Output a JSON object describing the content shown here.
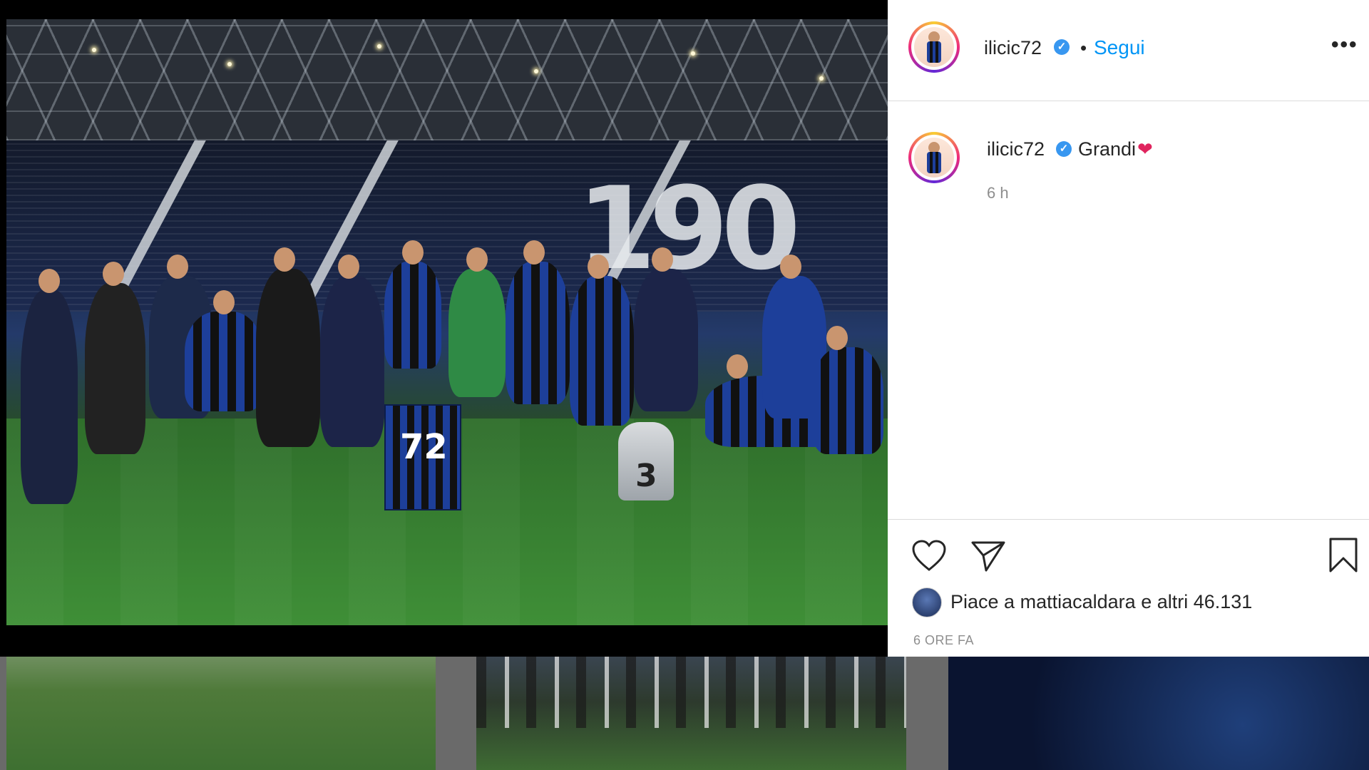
{
  "post": {
    "username": "ilicic72",
    "follow_label": "Segui",
    "separator": "•",
    "more_label": "•••",
    "caption": {
      "username": "ilicic72",
      "text": "Grandi",
      "emoji": "❤",
      "time": "6 h"
    },
    "photo": {
      "jersey_number": "72",
      "trophy_number": "3",
      "stand_numeral": "190"
    },
    "likes": {
      "prefix": "Piace a",
      "liked_by": "mattiacaldara",
      "connector": "e altri",
      "count": "46.131"
    },
    "age": "6 ORE FA"
  },
  "icons": {
    "like": "heart-outline-icon",
    "share": "paper-plane-icon",
    "save": "bookmark-icon",
    "verified": "verified-badge-icon"
  },
  "colors": {
    "link": "#0095f6",
    "verified": "#3897f0",
    "heart": "#e0245e",
    "text": "#262626",
    "muted": "#8e8e8e"
  }
}
